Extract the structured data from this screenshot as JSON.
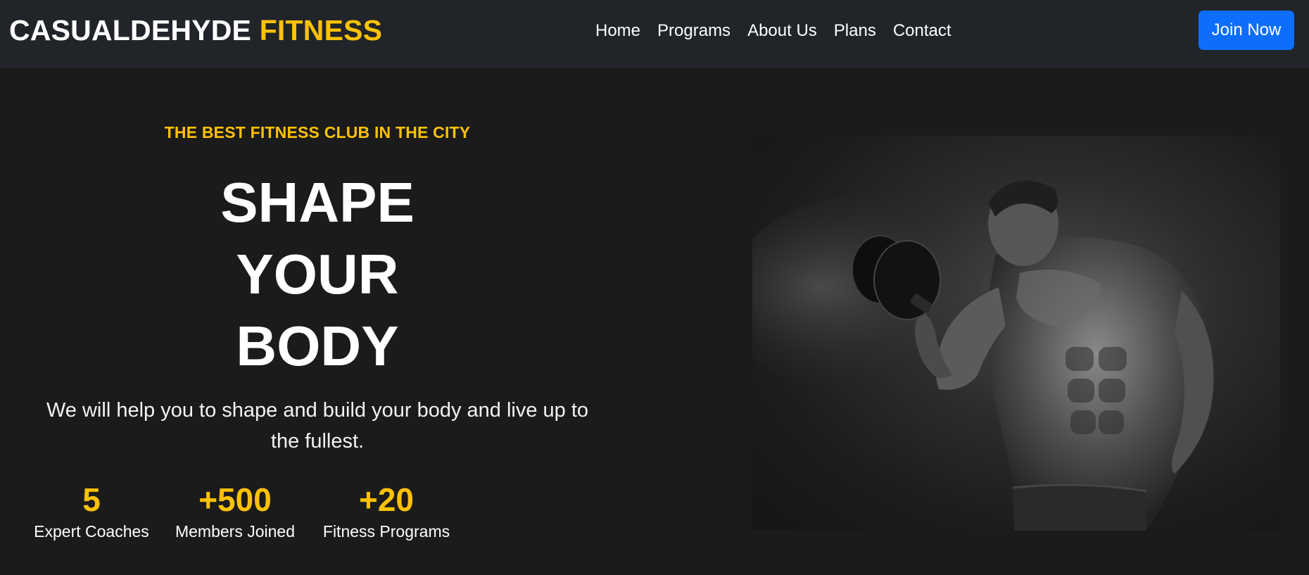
{
  "navbar": {
    "brand_primary": "CASUALDEHYDE",
    "brand_accent": "FITNESS",
    "links": [
      {
        "label": "Home"
      },
      {
        "label": "Programs"
      },
      {
        "label": "About Us"
      },
      {
        "label": "Plans"
      },
      {
        "label": "Contact"
      }
    ],
    "cta_label": "Join Now"
  },
  "hero": {
    "eyebrow": "THE BEST FITNESS CLUB IN THE CITY",
    "headline_lines": [
      "SHAPE",
      "YOUR",
      "BODY"
    ],
    "subtitle": "We will help you to shape and build your body and live up to the fullest.",
    "stats": [
      {
        "value": "5",
        "label": "Expert Coaches"
      },
      {
        "value": "+500",
        "label": "Members Joined"
      },
      {
        "value": "+20",
        "label": "Fitness Programs"
      }
    ],
    "image": {
      "icon": "bodybuilder-photo"
    }
  },
  "colors": {
    "accent": "#ffc107",
    "primary_button": "#0d6efd",
    "navbar_bg": "#212429",
    "page_bg": "#1b1b1c"
  }
}
